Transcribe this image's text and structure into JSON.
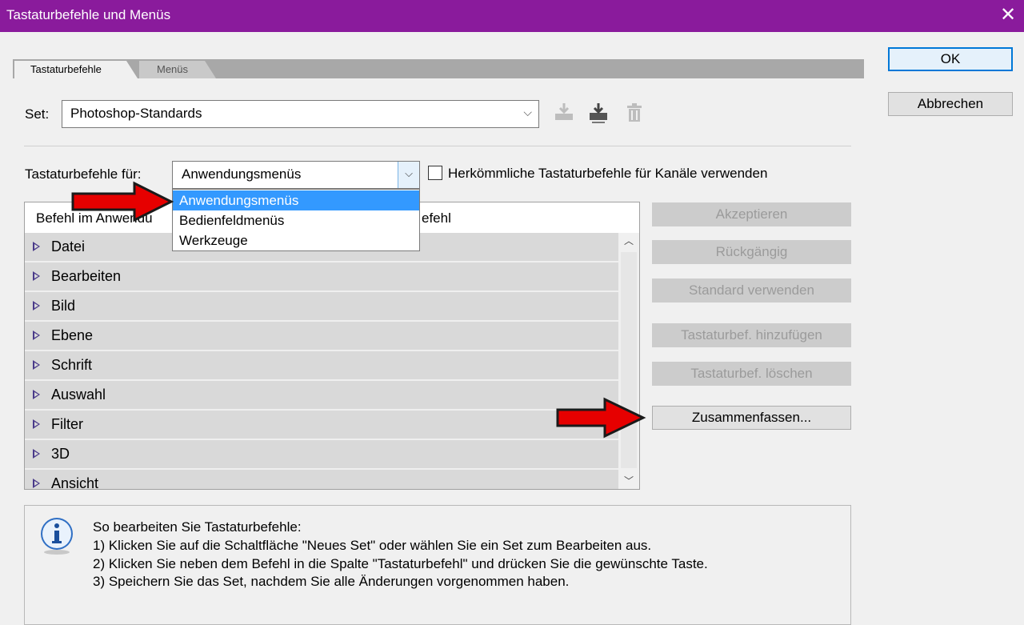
{
  "window": {
    "title": "Tastaturbefehle und Menüs",
    "close_glyph": "✕"
  },
  "tabs": {
    "active": "Tastaturbefehle",
    "inactive": "Menüs"
  },
  "set": {
    "label": "Set:",
    "value": "Photoshop-Standards"
  },
  "shortcuts_for": {
    "label": "Tastaturbefehle für:",
    "value": "Anwendungsmenüs",
    "options": [
      "Anwendungsmenüs",
      "Bedienfeldmenüs",
      "Werkzeuge"
    ],
    "selected_option_index": 0
  },
  "legacy_checkbox": {
    "label": "Herkömmliche Tastaturbefehle für Kanäle verwenden",
    "checked": false
  },
  "table": {
    "col1_header": "Befehl im Anwendu",
    "col2_header": "efehl",
    "rows": [
      "Datei",
      "Bearbeiten",
      "Bild",
      "Ebene",
      "Schrift",
      "Auswahl",
      "Filter",
      "3D",
      "Ansicht"
    ]
  },
  "buttons": {
    "ok": "OK",
    "cancel": "Abbrechen",
    "accept": "Akzeptieren",
    "undo": "Rückgängig",
    "use_default": "Standard verwenden",
    "add_shortcut": "Tastaturbef. hinzufügen",
    "delete_shortcut": "Tastaturbef. löschen",
    "summarize": "Zusammenfassen..."
  },
  "info": {
    "heading": "So bearbeiten Sie Tastaturbefehle:",
    "lines": [
      "1) Klicken Sie auf die Schaltfläche \"Neues Set\" oder wählen Sie ein Set zum Bearbeiten aus.",
      "2) Klicken Sie neben dem Befehl in die Spalte \"Tastaturbefehl\" und drücken Sie die gewünschte Taste.",
      "3) Speichern Sie das Set, nachdem Sie alle Änderungen vorgenommen haben."
    ]
  },
  "icons": {
    "save_set": "save-set-icon",
    "save_set_as": "save-set-as-icon",
    "delete_set": "trash-icon",
    "info": "info-icon",
    "dropdown": "chevron-down-icon",
    "arrow": "red-arrow-icon"
  },
  "colors": {
    "titlebar": "#8a1b9c",
    "selection": "#3399ff",
    "arrow_red": "#e60000",
    "ok_border": "#0078d7"
  }
}
